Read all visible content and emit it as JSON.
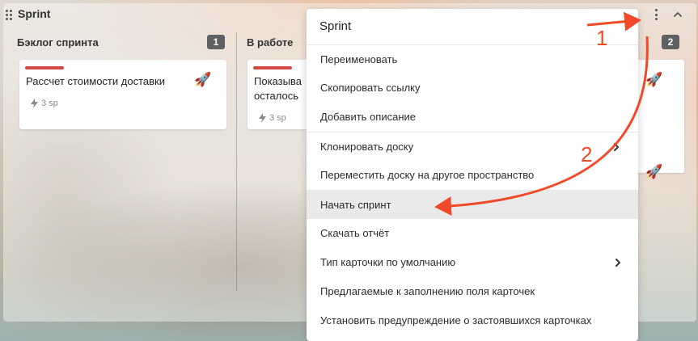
{
  "board": {
    "title": "Sprint",
    "columns": [
      {
        "title": "Бэклог спринта",
        "count": "1",
        "cards": [
          {
            "title": "Рассчет стоимости доставки",
            "points": "3 sp",
            "icon": "rocket-icon"
          }
        ]
      },
      {
        "title": "В работе",
        "count": "",
        "cards": [
          {
            "title_line1": "Показыва",
            "title_line2": "осталось",
            "points": "3 sp",
            "icon": ""
          }
        ]
      },
      {
        "title": "",
        "count": "2",
        "cards": [
          {
            "icon": "rocket-icon"
          },
          {
            "icon": "rocket-icon"
          }
        ]
      }
    ]
  },
  "menu": {
    "title": "Sprint",
    "items": [
      {
        "label": "Переименовать"
      },
      {
        "label": "Скопировать ссылку"
      },
      {
        "label": "Добавить описание"
      },
      {
        "label": "Клонировать доску"
      },
      {
        "label": "Переместить доску на другое пространство"
      },
      {
        "label": "Начать спринт"
      },
      {
        "label": "Скачать отчёт"
      },
      {
        "label": "Тип карточки по умолчанию"
      },
      {
        "label": "Предлагаемые к заполнению поля карточек"
      },
      {
        "label": "Установить предупреждение о застоявшихся карточках"
      }
    ]
  },
  "annotations": {
    "step1": "1",
    "step2": "2",
    "color": "#f04a2a"
  },
  "colors": {
    "card_stripe": "#d24a45",
    "badge": "#5f6061",
    "menu_active": "#eaeaea"
  }
}
